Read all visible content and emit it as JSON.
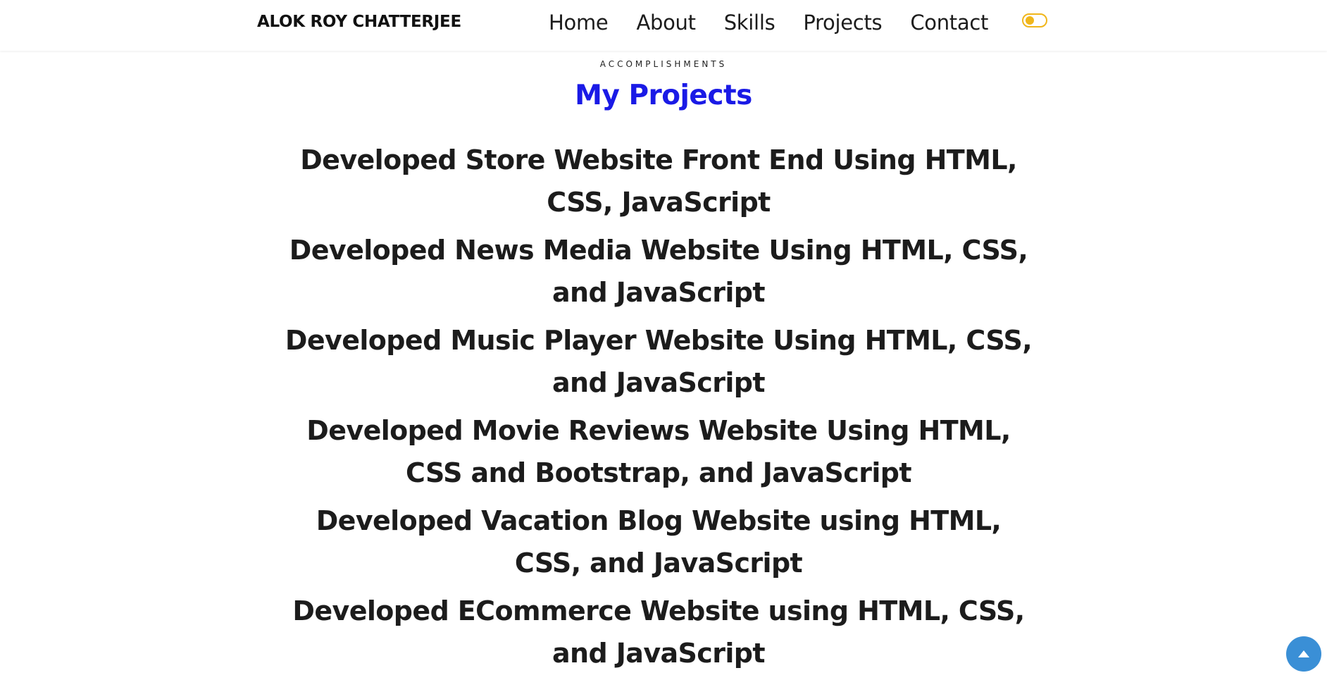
{
  "header": {
    "brand": "ALOK ROY CHATTERJEE",
    "nav": [
      {
        "label": "Home"
      },
      {
        "label": "About"
      },
      {
        "label": "Skills"
      },
      {
        "label": "Projects"
      },
      {
        "label": "Contact"
      }
    ],
    "theme_toggle_icon": "toggle-switch-icon",
    "accent_color": "#f0b61b"
  },
  "projects_section": {
    "eyebrow": "ACCOMPLISHMENTS",
    "title": "My Projects",
    "title_color": "#1a1ae6",
    "items": [
      {
        "text": "Developed Store Website Front End Using HTML, CSS, JavaScript"
      },
      {
        "text": "Developed News Media Website Using HTML, CSS, and JavaScript"
      },
      {
        "text": "Developed Music Player Website Using HTML, CSS, and JavaScript"
      },
      {
        "text": "Developed Movie Reviews Website Using HTML, CSS and Bootstrap, and JavaScript"
      },
      {
        "text": "Developed Vacation Blog Website using HTML, CSS, and JavaScript"
      },
      {
        "text": "Developed ECommerce Website using HTML, CSS, and JavaScript"
      }
    ]
  },
  "scroll_top": {
    "icon": "caret-up-icon",
    "color": "#3a8fd6"
  }
}
